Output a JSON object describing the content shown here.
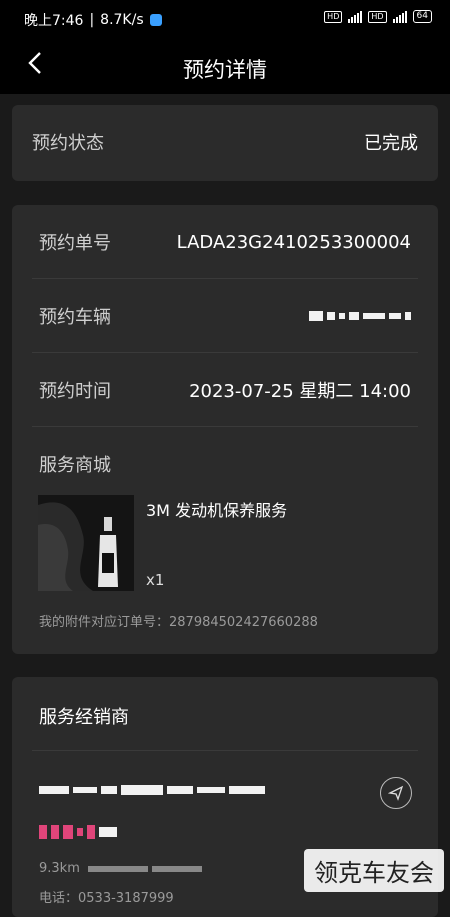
{
  "status_bar": {
    "time": "晚上7:46",
    "speed": "8.7K/s",
    "battery": "64"
  },
  "header": {
    "title": "预约详情",
    "back_icon": "chevron-left-icon"
  },
  "status_card": {
    "label": "预约状态",
    "value": "已完成"
  },
  "detail_card": {
    "order_no_label": "预约单号",
    "order_no": "LADA23G2410253300004",
    "vehicle_label": "预约车辆",
    "time_label": "预约时间",
    "time_value": "2023-07-25 星期二 14:00",
    "mall_label": "服务商城",
    "product_name": "3M 发动机保养服务",
    "product_qty": "x1",
    "attachment_label": "我的附件对应订单号：",
    "attachment_no": "287984502427660288"
  },
  "dealer_card": {
    "title": "服务经销商",
    "distance": "9.3km",
    "phone": "电话：0533-3187999",
    "nav_icon": "navigation-arrow-icon"
  },
  "watermark": "领克车友会"
}
